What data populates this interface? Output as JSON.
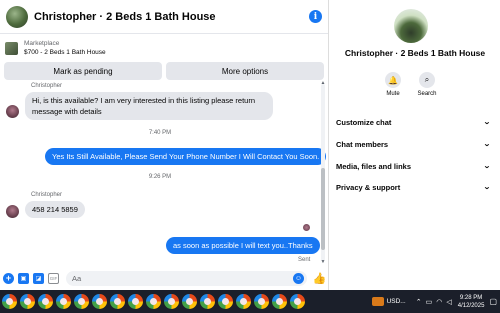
{
  "header": {
    "title": "Christopher · 2 Beds 1 Bath House",
    "info_icon": "i"
  },
  "marketplace": {
    "label": "Marketplace",
    "item": "$700 - 2 Beds 1 Bath House"
  },
  "actions": {
    "pending": "Mark as pending",
    "more": "More options"
  },
  "messages": {
    "sender1": "Christopher",
    "msg1": "Hi, is this available? I am very interested in this listing please return message with details",
    "time1": "7:40 PM",
    "reply1": "Yes Its Still Available, Please Send Your Phone Number I Will Contact You Soon.",
    "time2": "9:26 PM",
    "sender2": "Christopher",
    "msg2": "458 214 5859",
    "reply2": "as soon as possible I will text you..Thanks",
    "status": "Sent"
  },
  "composer": {
    "placeholder": "Aa"
  },
  "info_panel": {
    "title": "Christopher · 2 Beds 1 Bath House",
    "mute": "Mute",
    "search": "Search",
    "sections": [
      "Customize chat",
      "Chat members",
      "Media, files and links",
      "Privacy & support"
    ]
  },
  "taskbar": {
    "tray_label": "USD...",
    "time": "9:28 PM",
    "date": "4/12/2025"
  },
  "colors": {
    "accent": "#1877f2",
    "bubble_in": "#e4e6eb",
    "taskbar": "#1b1f2a"
  }
}
